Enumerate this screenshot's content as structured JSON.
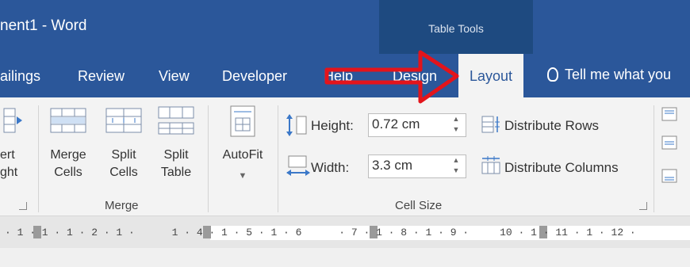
{
  "title": "nent1  -  Word",
  "table_tools": "Table Tools",
  "tabs": {
    "mailings": "ailings",
    "review": "Review",
    "view": "View",
    "developer": "Developer",
    "help": "Help",
    "design": "Design",
    "layout": "Layout"
  },
  "tell_me": "Tell me what you",
  "ribbon": {
    "insert_cut": {
      "line1": "ert",
      "line2": "ght"
    },
    "merge_cells": {
      "line1": "Merge",
      "line2": "Cells"
    },
    "split_cells": {
      "line1": "Split",
      "line2": "Cells"
    },
    "split_table": {
      "line1": "Split",
      "line2": "Table"
    },
    "autofit": "AutoFit",
    "merge_group": "Merge",
    "height_label": "Height:",
    "height_value": "0.72 cm",
    "width_label": "Width:",
    "width_value": "3.3 cm",
    "distribute_rows": "Distribute Rows",
    "distribute_columns": "Distribute Columns",
    "cell_size_group": "Cell Size"
  },
  "ruler": "· 1 · 1 · 1 · 2 · 1 ·      1 · 4 · 1 · 5 · 1 · 6      · 7 · 1 · 8 · 1 · 9 ·     10 · 1 · 11 · 1 · 12 ·",
  "colors": {
    "title_bar": "#2b579a",
    "table_tools_bg": "#1e4a80",
    "ribbon_bg": "#f3f3f3",
    "annotation_arrow": "#e3141b"
  },
  "icons": [
    "table-icon",
    "lightbulb-icon",
    "spin-up-icon",
    "spin-down-icon",
    "distribute-rows-icon",
    "distribute-columns-icon",
    "align-icon",
    "annotation-arrow-icon",
    "dialog-launcher-icon"
  ]
}
